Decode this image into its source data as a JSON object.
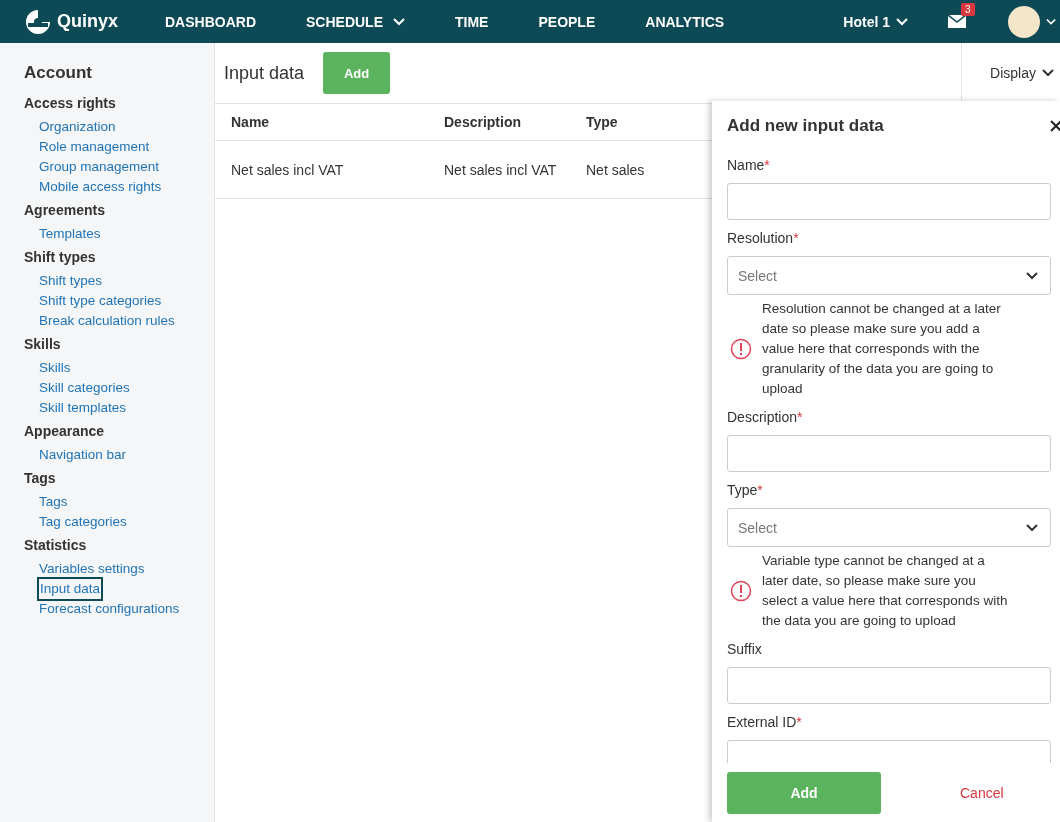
{
  "header": {
    "brand": "Quinyx",
    "nav": [
      {
        "label": "DASHBOARD",
        "has_dropdown": false
      },
      {
        "label": "SCHEDULE",
        "has_dropdown": true
      },
      {
        "label": "TIME",
        "has_dropdown": false
      },
      {
        "label": "PEOPLE",
        "has_dropdown": false
      },
      {
        "label": "ANALYTICS",
        "has_dropdown": false
      }
    ],
    "unit": "Hotel 1",
    "mail_badge": "3"
  },
  "sidebar": {
    "title": "Account",
    "sections": [
      {
        "heading": "Access rights",
        "items": [
          {
            "label": "Organization",
            "selected": false
          },
          {
            "label": "Role management",
            "selected": false
          },
          {
            "label": "Group management",
            "selected": false
          },
          {
            "label": "Mobile access rights",
            "selected": false
          }
        ]
      },
      {
        "heading": "Agreements",
        "items": [
          {
            "label": "Templates",
            "selected": false
          }
        ]
      },
      {
        "heading": "Shift types",
        "items": [
          {
            "label": "Shift types",
            "selected": false
          },
          {
            "label": "Shift type categories",
            "selected": false
          },
          {
            "label": "Break calculation rules",
            "selected": false
          }
        ]
      },
      {
        "heading": "Skills",
        "items": [
          {
            "label": "Skills",
            "selected": false
          },
          {
            "label": "Skill categories",
            "selected": false
          },
          {
            "label": "Skill templates",
            "selected": false
          }
        ]
      },
      {
        "heading": "Appearance",
        "items": [
          {
            "label": "Navigation bar",
            "selected": false
          }
        ]
      },
      {
        "heading": "Tags",
        "items": [
          {
            "label": "Tags",
            "selected": false
          },
          {
            "label": "Tag categories",
            "selected": false
          }
        ]
      },
      {
        "heading": "Statistics",
        "items": [
          {
            "label": "Variables settings",
            "selected": false
          },
          {
            "label": "Input data",
            "selected": true
          },
          {
            "label": "Forecast configurations",
            "selected": false
          }
        ]
      }
    ]
  },
  "page": {
    "title": "Input data",
    "add_button": "Add",
    "display_menu": "Display"
  },
  "table": {
    "columns": [
      "Name",
      "Description",
      "Type"
    ],
    "rows": [
      [
        "Net sales incl VAT",
        "Net sales incl VAT",
        "Net sales"
      ]
    ]
  },
  "panel": {
    "title": "Add new input data",
    "fields": [
      {
        "kind": "text",
        "label": "Name",
        "required_mark": "*"
      },
      {
        "kind": "select",
        "label": "Resolution",
        "required_mark": "*",
        "placeholder": "Select",
        "note": "Resolution cannot be changed at a later date so please make sure you add a value here that corresponds with the granularity of the data you are going to upload"
      },
      {
        "kind": "text",
        "label": "Description",
        "required_mark": "*"
      },
      {
        "kind": "select",
        "label": "Type",
        "required_mark": "*",
        "placeholder": "Select",
        "note": "Variable type cannot be changed at a later date, so please make sure you select a value here that corresponds with the data you are going to upload"
      },
      {
        "kind": "text",
        "label": "Suffix"
      },
      {
        "kind": "text",
        "label": "External ID",
        "required_mark": "*"
      }
    ],
    "submit": "Add",
    "cancel": "Cancel"
  }
}
